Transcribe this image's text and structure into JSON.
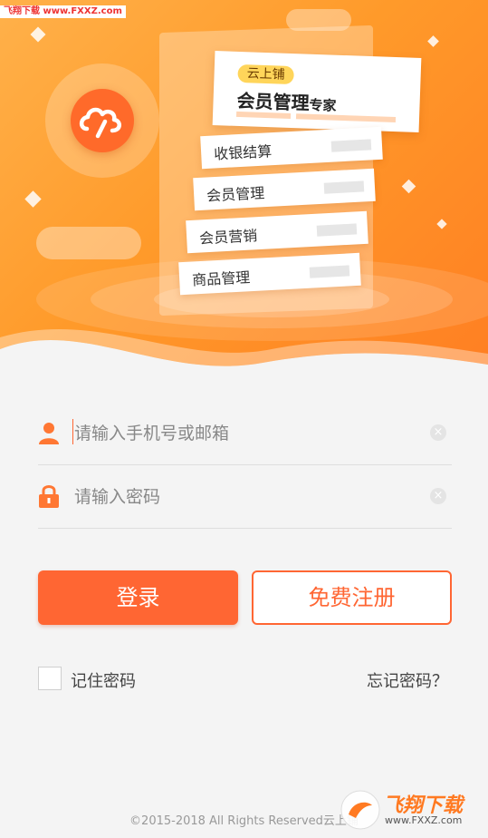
{
  "watermark": {
    "top": "飞翔下载 www.FXXZ.com",
    "bottom_brand": "飞翔下载",
    "bottom_url": "www.FXXZ.com"
  },
  "hero": {
    "badge": "云上铺",
    "title_main": "会员管理",
    "title_suffix": "专家",
    "features": [
      "收银结算",
      "会员管理",
      "会员营销",
      "商品管理"
    ]
  },
  "form": {
    "phone_placeholder": "请输入手机号或邮箱",
    "password_placeholder": "请输入密码",
    "clear_icon": "×"
  },
  "buttons": {
    "login": "登录",
    "register": "免费注册"
  },
  "options": {
    "remember": "记住密码",
    "forgot": "忘记密码？"
  },
  "footer": "©2015-2018  All  Rights  Reserved云上铺",
  "colors": {
    "accent": "#ff6633",
    "hero_start": "#ffb14a",
    "hero_end": "#ff7e22"
  }
}
